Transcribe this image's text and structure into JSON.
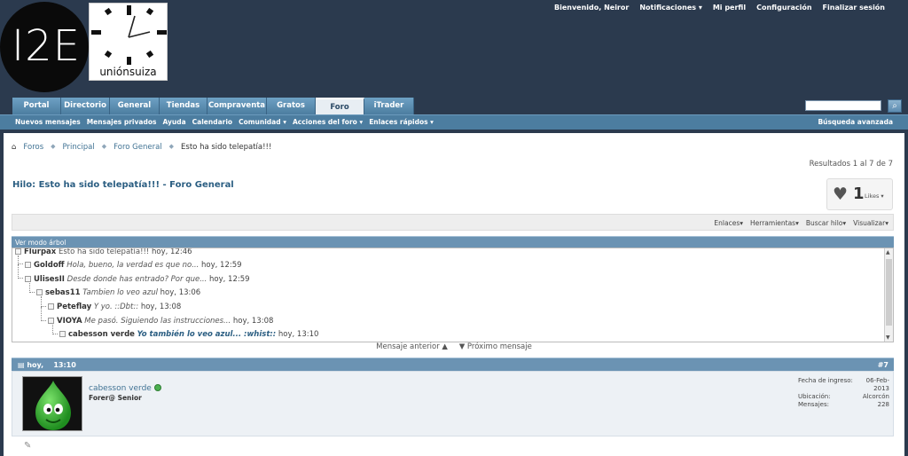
{
  "header": {
    "logo_text": "I2E",
    "brand_text": "uniónsuiza",
    "toplinks": {
      "welcome": "Bienvenido, Neiror",
      "notifications": "Notificaciones",
      "profile": "Mi perfil",
      "settings": "Configuración",
      "logout": "Finalizar sesión"
    }
  },
  "nav": {
    "tabs": [
      "Portal",
      "Directorio",
      "General",
      "Tiendas",
      "Compraventa",
      "Gratos",
      "Foro",
      "iTrader"
    ],
    "active_tab": "Foro"
  },
  "subnav": {
    "items": [
      "Nuevos mensajes",
      "Mensajes privados",
      "Ayuda",
      "Calendario",
      "Comunidad ▾",
      "Acciones del foro ▾",
      "Enlaces rápidos ▾"
    ],
    "advanced_search": "Búsqueda avanzada"
  },
  "breadcrumb": {
    "items": [
      "Foros",
      "Principal",
      "Foro General"
    ],
    "current": "Esto ha sido telepatía!!!"
  },
  "results": "Resultados 1 al 7 de 7",
  "thread": {
    "label": "Hilo:",
    "title": "Esto ha sido telepatía!!! - Foro General"
  },
  "likes": {
    "count": "1",
    "label": "Likes ▾"
  },
  "tools": [
    "Enlaces▾",
    "Herramientas▾",
    "Buscar hilo▾",
    "Visualizar▾"
  ],
  "tree": {
    "header": "Ver modo árbol",
    "rows": [
      {
        "author": "Flurpax",
        "snippet": "Esto ha sido telepatía!!!",
        "time": "hoy, 12:46"
      },
      {
        "author": "Goldoff",
        "snippet": "Hola, bueno, la verdad es que no...",
        "time": "hoy, 12:59"
      },
      {
        "author": "UlisesII",
        "snippet": "Desde donde has entrado? Por que...",
        "time": "hoy, 12:59"
      },
      {
        "author": "sebas11",
        "snippet": "Tambien lo veo azul",
        "time": "hoy, 13:06"
      },
      {
        "author": "Peteflay",
        "snippet": "Y yo. ::Dbt::",
        "time": "hoy, 13:08"
      },
      {
        "author": "VIOYA",
        "snippet": "Me pasó. Siguiendo las instrucciones...",
        "time": "hoy, 13:08"
      },
      {
        "author": "cabesson verde",
        "snippet": "Yo también lo veo azul... :whist::",
        "time": "hoy, 13:10"
      }
    ]
  },
  "message_nav": {
    "previous": "Mensaje anterior ▲",
    "next": "▼ Próximo mensaje"
  },
  "post": {
    "date": "hoy,",
    "time": "13:10",
    "number": "#7",
    "username": "cabesson verde",
    "usertitle": "Forer@ Senior",
    "info": [
      {
        "label": "Fecha de ingreso:",
        "value": "06-Feb-2013"
      },
      {
        "label": "Ubicación:",
        "value": "Alcorcón"
      },
      {
        "label": "Mensajes:",
        "value": "228"
      }
    ]
  }
}
